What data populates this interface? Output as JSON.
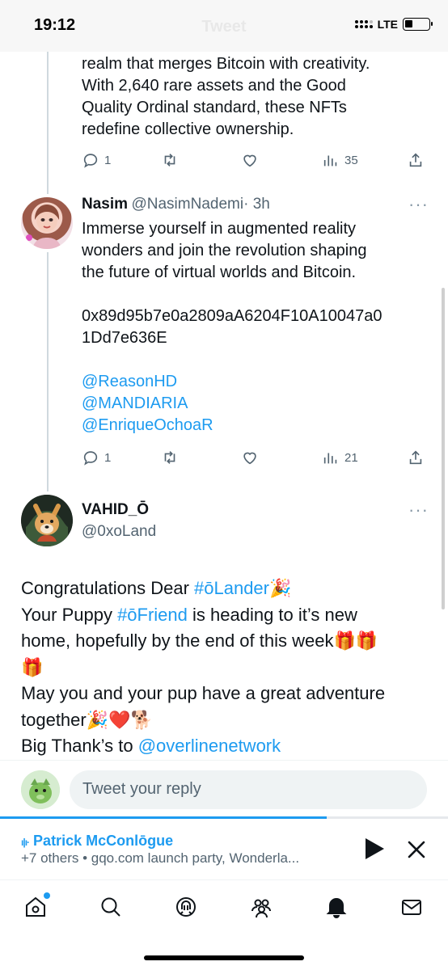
{
  "status_bar": {
    "time": "19:12",
    "title": "Tweet",
    "network": "LTE"
  },
  "tweet_top": {
    "text_lines": [
      "realm that merges Bitcoin with creativity.",
      "With 2,640 rare assets and the Good",
      "Quality Ordinal standard, these NFTs",
      "redefine collective ownership."
    ],
    "replies": "1",
    "views": "35"
  },
  "tweet_nasim": {
    "name": "Nasim",
    "handle": "@NasimNademi",
    "time": "· 3h",
    "text_lines": [
      "Immerse yourself in augmented reality",
      "wonders and join the revolution shaping",
      "the future of virtual worlds and Bitcoin."
    ],
    "address_lines": [
      "0x89d95b7e0a2809aA6204F10A10047a0",
      "1Dd7e636E"
    ],
    "mentions": [
      "@ReasonHD",
      "@MANDIARIA",
      "@EnriqueOchoaR"
    ],
    "replies": "1",
    "views": "21"
  },
  "tweet_main": {
    "name": "VAHID_Ō",
    "handle": "@0xoLand",
    "line1_pre": "Congratulations Dear ",
    "line1_tag": "#ōLander",
    "line1_emoji": "🎉",
    "line2_pre": "Your Puppy ",
    "line2_tag": "#ōFriend",
    "line2_post": " is heading to it’s new",
    "line3": "home, hopefully by the end of this week",
    "line3_emoji": "🎁🎁",
    "line4_emoji": "🎁",
    "line5": "May you and your pup have a great adventure",
    "line6": "together",
    "line6_emoji": "🎉❤️🐕",
    "line7_pre": "Big Thank’s to ",
    "line7_link": "@overlinenetwork"
  },
  "reply_bar": {
    "placeholder": "Tweet your reply"
  },
  "space_bar": {
    "progress": 0.73,
    "host": "Patrick McConlōgue",
    "subtitle": "+7 others • gqo.com launch party, Wonderla..."
  },
  "icons": {
    "reply": "reply-icon",
    "retweet": "retweet-icon",
    "like": "heart-icon",
    "views": "views-icon",
    "share": "share-icon",
    "home": "home-icon",
    "search": "search-icon",
    "spaces": "spaces-icon",
    "communities": "communities-icon",
    "notifications": "bell-icon",
    "messages": "mail-icon"
  },
  "colors": {
    "accent": "#1d9bf0",
    "text": "#0f1419",
    "muted": "#536471"
  }
}
